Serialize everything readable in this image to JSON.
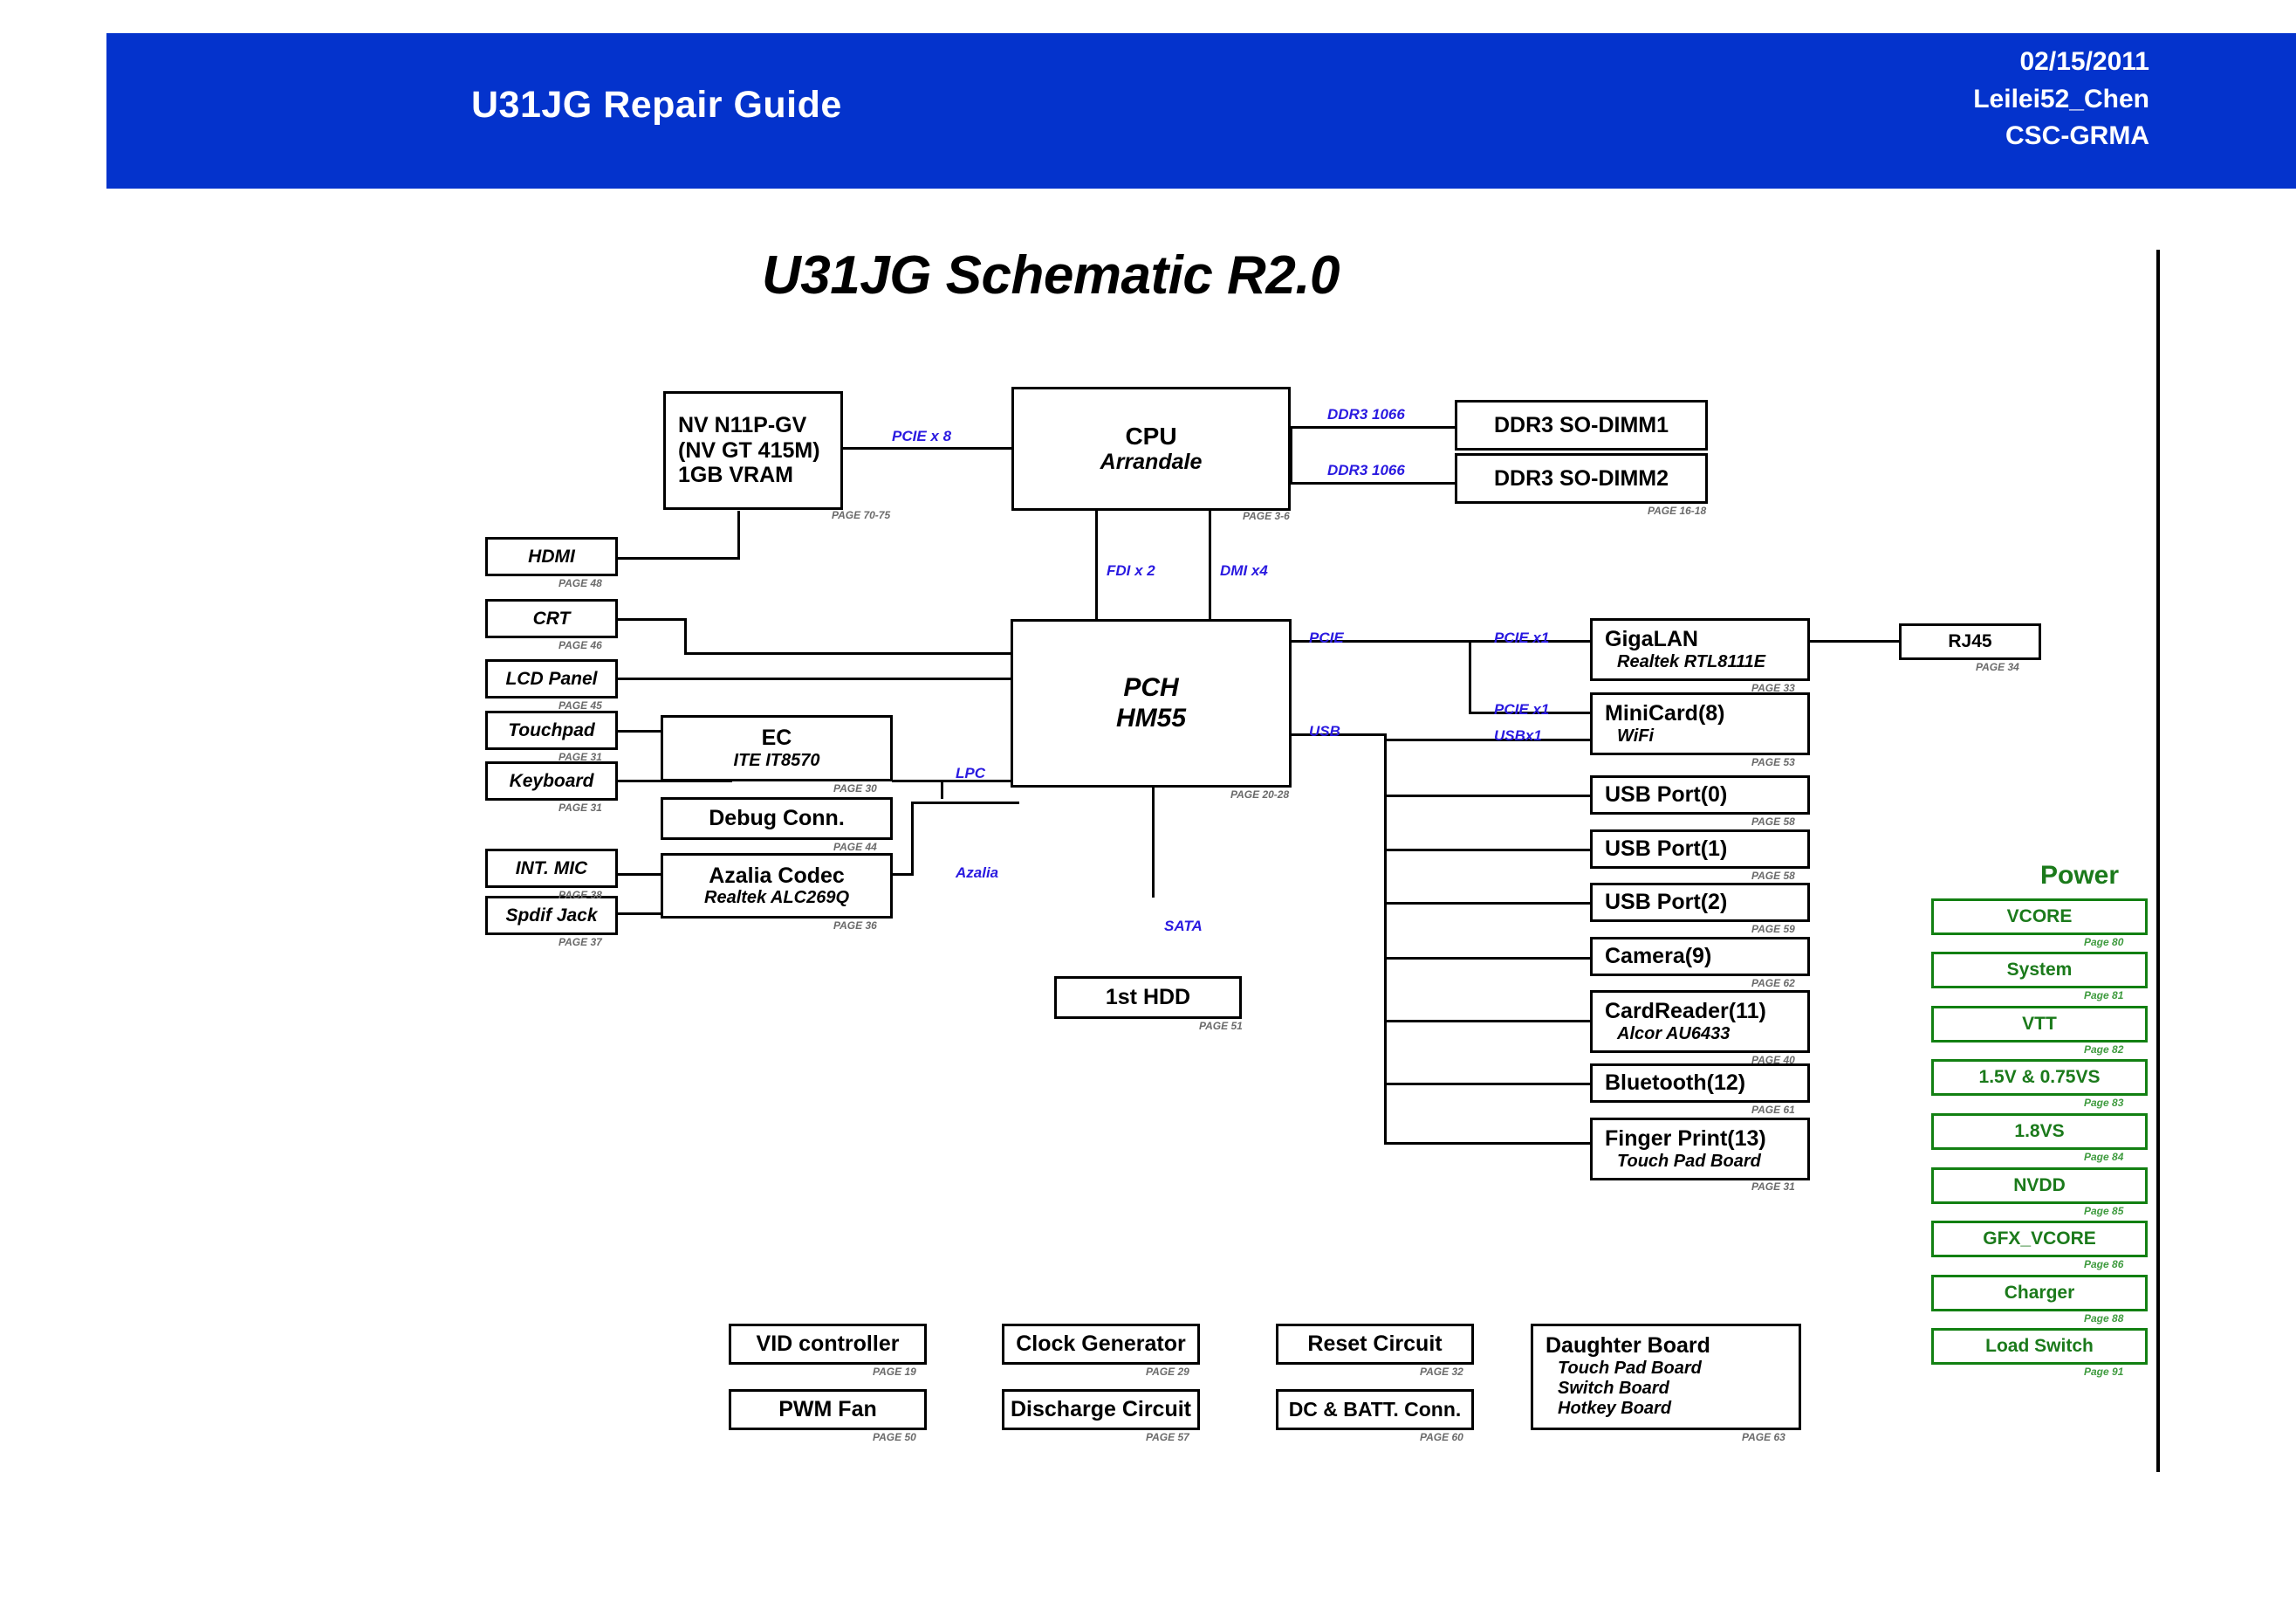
{
  "header": {
    "title": "U31JG Repair Guide",
    "date": "02/15/2011",
    "author": "Leilei52_Chen",
    "org": "CSC-GRMA",
    "banner_color": "#0433CC"
  },
  "schematic": {
    "title": "U31JG Schematic R2.0",
    "power_section_title": "Power",
    "power_color": "#128012",
    "bus_label_color": "#2A1AE0"
  },
  "blocks": {
    "gpu": {
      "line1": "NV N11P-GV",
      "line2": "(NV GT 415M)",
      "line3": "1GB VRAM",
      "page": "PAGE 70-75"
    },
    "cpu": {
      "line1": "CPU",
      "line2": "Arrandale",
      "page": "PAGE 3-6"
    },
    "dimm1": {
      "label": "DDR3 SO-DIMM1"
    },
    "dimm2": {
      "label": "DDR3 SO-DIMM2",
      "page": "PAGE 16-18"
    },
    "hdmi": {
      "label": "HDMI",
      "page": "PAGE 48"
    },
    "crt": {
      "label": "CRT",
      "page": "PAGE 46"
    },
    "lcd": {
      "label": "LCD Panel",
      "page": "PAGE 45"
    },
    "touchpad": {
      "label": "Touchpad",
      "page": "PAGE 31"
    },
    "keyboard": {
      "label": "Keyboard",
      "page": "PAGE 31"
    },
    "intmic": {
      "label": "INT. MIC",
      "page": "PAGE 38"
    },
    "spdif": {
      "label": "Spdif Jack",
      "page": "PAGE 37"
    },
    "ec": {
      "line1": "EC",
      "line2": "ITE IT8570",
      "page": "PAGE 30"
    },
    "debug": {
      "label": "Debug Conn.",
      "page": "PAGE 44"
    },
    "azalia": {
      "line1": "Azalia Codec",
      "line2": "Realtek ALC269Q",
      "page": "PAGE 36"
    },
    "pch": {
      "line1": "PCH",
      "line2": "HM55",
      "page": "PAGE 20-28"
    },
    "hdd": {
      "label": "1st HDD",
      "page": "PAGE 51"
    },
    "gigalan": {
      "line1": "GigaLAN",
      "line2": "Realtek RTL8111E",
      "page": "PAGE 33"
    },
    "rj45": {
      "label": "RJ45",
      "page": "PAGE 34"
    },
    "minicard": {
      "line1": "MiniCard(8)",
      "line2": "WiFi",
      "page": "PAGE 53"
    },
    "usb0": {
      "label": "USB Port(0)",
      "page": "PAGE 58"
    },
    "usb1": {
      "label": "USB Port(1)",
      "page": "PAGE 58"
    },
    "usb2": {
      "label": "USB Port(2)",
      "page": "PAGE 59"
    },
    "camera": {
      "label": "Camera(9)",
      "page": "PAGE 62"
    },
    "cardreader": {
      "line1": "CardReader(11)",
      "line2": "Alcor AU6433",
      "page": "PAGE 40"
    },
    "bluetooth": {
      "label": "Bluetooth(12)",
      "page": "PAGE 61"
    },
    "fingerprint": {
      "line1": "Finger Print(13)",
      "line2": "Touch Pad Board",
      "page": "PAGE 31"
    },
    "vid": {
      "label": "VID controller",
      "page": "PAGE 19"
    },
    "pwmfan": {
      "label": "PWM Fan",
      "page": "PAGE 50"
    },
    "clockgen": {
      "label": "Clock Generator",
      "page": "PAGE 29"
    },
    "discharge": {
      "label": "Discharge Circuit",
      "page": "PAGE 57"
    },
    "reset": {
      "label": "Reset Circuit",
      "page": "PAGE 32"
    },
    "dcbatt": {
      "label": "DC & BATT. Conn.",
      "page": "PAGE 60"
    },
    "daughter": {
      "line1": "Daughter Board",
      "line2": "Touch Pad Board",
      "line3": "Switch Board",
      "line4": "Hotkey Board",
      "page": "PAGE 63"
    }
  },
  "bus_labels": {
    "pcie_x8": "PCIE x 8",
    "ddr3_1066_a": "DDR3 1066",
    "ddr3_1066_b": "DDR3 1066",
    "fdi_x2": "FDI x 2",
    "dmi_x4": "DMI x4",
    "pcie": "PCIE",
    "usb": "USB",
    "pcie_x1_a": "PCIE x1",
    "pcie_x1_b": "PCIE x1",
    "usb_x1": "USBx1",
    "lpc": "LPC",
    "azalia": "Azalia",
    "sata": "SATA"
  },
  "power_rails": [
    {
      "label": "VCORE",
      "page": "Page 80"
    },
    {
      "label": "System",
      "page": "Page 81"
    },
    {
      "label": "VTT",
      "page": "Page 82"
    },
    {
      "label": "1.5V & 0.75VS",
      "page": "Page 83"
    },
    {
      "label": "1.8VS",
      "page": "Page 84"
    },
    {
      "label": "NVDD",
      "page": "Page 85"
    },
    {
      "label": "GFX_VCORE",
      "page": "Page 86"
    },
    {
      "label": "Charger",
      "page": "Page 88"
    },
    {
      "label": "Load Switch",
      "page": "Page 91"
    }
  ]
}
